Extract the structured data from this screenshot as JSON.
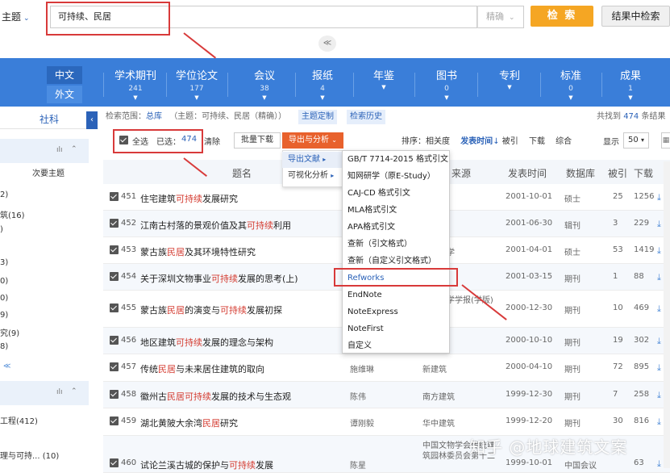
{
  "search": {
    "subject_label": "主题",
    "query": "可持续、民居",
    "precision": "精确",
    "search_button": "检 索",
    "in_results_button": "结果中检索"
  },
  "nav": {
    "lang_cn": "中文",
    "lang_en": "外文",
    "tabs": [
      {
        "label": "学术期刊",
        "count": "241"
      },
      {
        "label": "学位论文",
        "count": "177"
      },
      {
        "label": "会议",
        "count": "38"
      },
      {
        "label": "报纸",
        "count": "4"
      },
      {
        "label": "年鉴",
        "count": ""
      },
      {
        "label": "图书",
        "count": "0"
      },
      {
        "label": "专利",
        "count": ""
      },
      {
        "label": "标准",
        "count": "0"
      },
      {
        "label": "成果",
        "count": "1"
      }
    ]
  },
  "left": {
    "tab_label": "社科",
    "secondary_label": "次要主题",
    "items": [
      "2)",
      "筑(16)",
      ")",
      "",
      "3)",
      "0)",
      "0)",
      "9)",
      "究(9)",
      "8)"
    ],
    "items2": [
      "工程(412)",
      "理与可持... (10)"
    ]
  },
  "info": {
    "scope_label": "检索范围：",
    "scope_value": "总库",
    "query_text": "（主题：可持续、民居（精确））",
    "custom_theme": "主题定制",
    "history": "检索历史",
    "found_prefix": "共找到",
    "found_count": "474",
    "found_suffix": "条结果"
  },
  "toolbar": {
    "select_all": "全选",
    "selected_label": "已选：",
    "selected_count": "474",
    "clear": "清除",
    "batch_download": "批量下载",
    "export_analysis": "导出与分析",
    "sort_label": "排序：",
    "sort_relevance": "相关度",
    "sort_time": "发表时间",
    "sort_cited": "被引",
    "sort_download": "下载",
    "sort_combined": "综合",
    "show_label": "显示",
    "show_value": "50"
  },
  "export_menu": {
    "export_docs": "导出文献",
    "visual_analysis": "可视化分析",
    "formats": [
      "GB/T 7714-2015 格式引文",
      "知网研学（原E-Study）",
      "CAJ-CD 格式引文",
      "MLA格式引文",
      "APA格式引文",
      "查新（引文格式）",
      "查新（自定义引文格式）",
      "Refworks",
      "EndNote",
      "NoteExpress",
      "NoteFirst",
      "自定义"
    ]
  },
  "table": {
    "headers": {
      "title": "题名",
      "source": "来源",
      "date": "发表时间",
      "db": "数据库",
      "cited": "被引",
      "download": "下载"
    },
    "rows": [
      {
        "no": "451",
        "title_parts": [
          "住宅建筑",
          "可持续",
          "发展研究"
        ],
        "author": "",
        "source": "学",
        "date": "2001-10-01",
        "db": "硕士",
        "cited": "25",
        "downloads": "1256"
      },
      {
        "no": "452",
        "title_parts": [
          "江南古村落的景观价值及其",
          "可持续",
          "利用"
        ],
        "author": "",
        "source": "",
        "date": "2001-06-30",
        "db": "辑刊",
        "cited": "3",
        "downloads": "229"
      },
      {
        "no": "453",
        "title_parts": [
          "蒙古族",
          "民居",
          "及其环境特性研究"
        ],
        "author": "",
        "source": "科技大学",
        "date": "2001-04-01",
        "db": "硕士",
        "cited": "53",
        "downloads": "1419"
      },
      {
        "no": "454",
        "title_parts": [
          "关于深圳文物事业",
          "可持续",
          "发展的思考(上)"
        ],
        "author": "",
        "source": "与实践",
        "date": "2001-03-15",
        "db": "期刊",
        "cited": "1",
        "downloads": "88"
      },
      {
        "no": "455",
        "title_parts": [
          "蒙古族",
          "民居",
          "的演变与",
          "可持续",
          "发展初探"
        ],
        "author": "",
        "source": "工业大学学报(学版)",
        "date": "2000-12-30",
        "db": "期刊",
        "cited": "10",
        "downloads": "469"
      },
      {
        "no": "456",
        "title_parts": [
          "地区建筑",
          "可持续",
          "发展的理念与架构"
        ],
        "author": "",
        "source": "",
        "date": "2000-10-10",
        "db": "期刊",
        "cited": "19",
        "downloads": "302"
      },
      {
        "no": "457",
        "title_parts": [
          "传统",
          "民居",
          "与未来居住建筑的取向"
        ],
        "author": "施维琳",
        "source": "新建筑",
        "date": "2000-04-10",
        "db": "期刊",
        "cited": "72",
        "downloads": "895"
      },
      {
        "no": "458",
        "title_parts": [
          "徽州古",
          "民居",
          "可持续",
          "发展的技术与生态观"
        ],
        "author": "陈伟",
        "source": "南方建筑",
        "date": "1999-12-30",
        "db": "期刊",
        "cited": "7",
        "downloads": "258"
      },
      {
        "no": "459",
        "title_parts": [
          "湖北黄陂大余湾",
          "民居",
          "研究"
        ],
        "author": "谭刚毅",
        "source": "华中建筑",
        "date": "1999-12-20",
        "db": "期刊",
        "cited": "30",
        "downloads": "816"
      },
      {
        "no": "460",
        "title_parts": [
          "试论兰溪古城的保护与",
          "可持续",
          "发展"
        ],
        "author": "陈星",
        "source": "中国文物学会传统建筑园林委员会第十二",
        "date": "1999-10-01",
        "db": "中国会议",
        "cited": "",
        "downloads": "63"
      }
    ]
  },
  "watermark": "知乎 @地球建筑文案",
  "colors": {
    "accent_blue": "#3a7ed9",
    "search_orange": "#f5a623",
    "export_orange": "#e8612c",
    "highlight_red": "#d43b30",
    "annotation_red": "#d83a3a"
  }
}
